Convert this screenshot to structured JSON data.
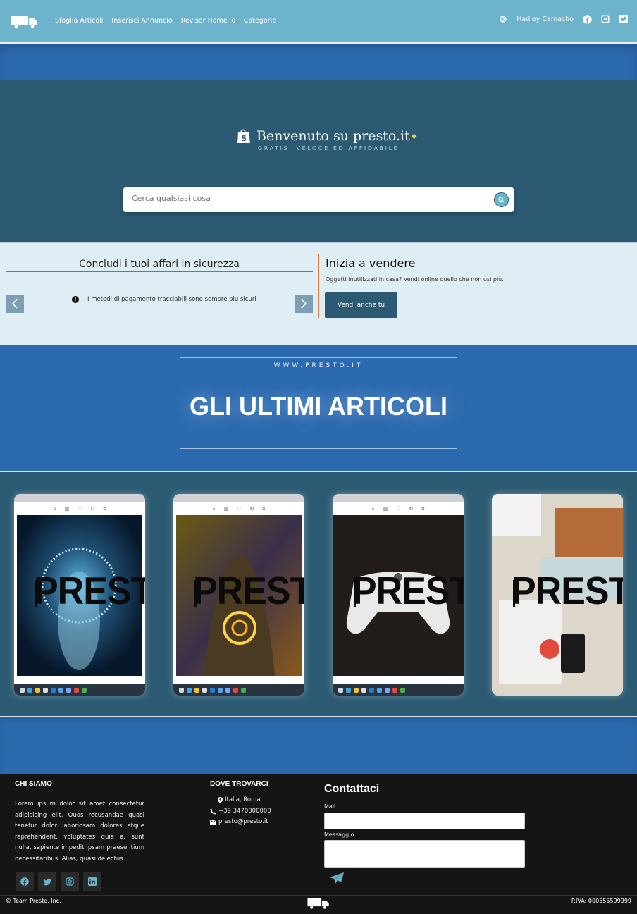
{
  "navbar": {
    "links": [
      "Sfoglia Articoli",
      "Inserisci Annuncio",
      "Revisor Home",
      "Categorie"
    ],
    "revisor_badge": "0",
    "user_name": "Hadley Camacho",
    "icons": [
      "globe-icon",
      "facebook-icon",
      "instagram-icon",
      "twitter-icon"
    ]
  },
  "hero": {
    "title": "Benvenuto su presto.it",
    "subtitle": "GRATIS, VELOCE ED AFFIDABILE",
    "search_placeholder": "Cerca qualsiasi cosa"
  },
  "info": {
    "left_title": "Concludi i tuoi affari in sicurezza",
    "carousel_text": "I metodi di pagamento tracciabili sono sempre piu sicuri",
    "sell_title": "Inizia a vendere",
    "sell_text": "Oggetti inutilizzati in casa? Vendi online quello che non usi più.",
    "sell_button": "Vendi anche tu"
  },
  "latest": {
    "url": "WWW.PRESTO.IT",
    "title": "GLI ULTIMI ARTICOLI"
  },
  "cards": [
    {
      "watermark": "PREST",
      "theme": "blue-portal"
    },
    {
      "watermark": "PREST",
      "theme": "hooded-figure"
    },
    {
      "watermark": "PREST",
      "theme": "game-controller"
    },
    {
      "watermark": "PREST",
      "theme": "desk-phone"
    }
  ],
  "footer": {
    "about_title": "CHI SIAMO",
    "about_text": "Lorem ipsum dolor sit amet consectetur adipisicing elit. Quos recusandae quasi tenetur dolor laboriosam dolores atque reprehenderit, voluptates quia a, sunt nulla, sapiente impedit ipsam praesentium necessitatibus. Alias, quasi delectus.",
    "where_title": "DOVE TROVARCI",
    "address": "Italia, Roma",
    "phone": "+39 3470000000",
    "email": "presto@presto.it",
    "contact_title": "Contattaci",
    "mail_label": "Mail",
    "message_label": "Messaggio",
    "copyright": "© Team Presto, Inc.",
    "piva": "P.IVA: 000555599999"
  },
  "colors": {
    "navbar": "#6cb3cb",
    "primary_blue": "#2c6aaf",
    "teal_dark": "#2b5a72",
    "info_bg": "#dfeef5",
    "footer_bg": "#151515",
    "accent_orange": "#e07b39"
  }
}
